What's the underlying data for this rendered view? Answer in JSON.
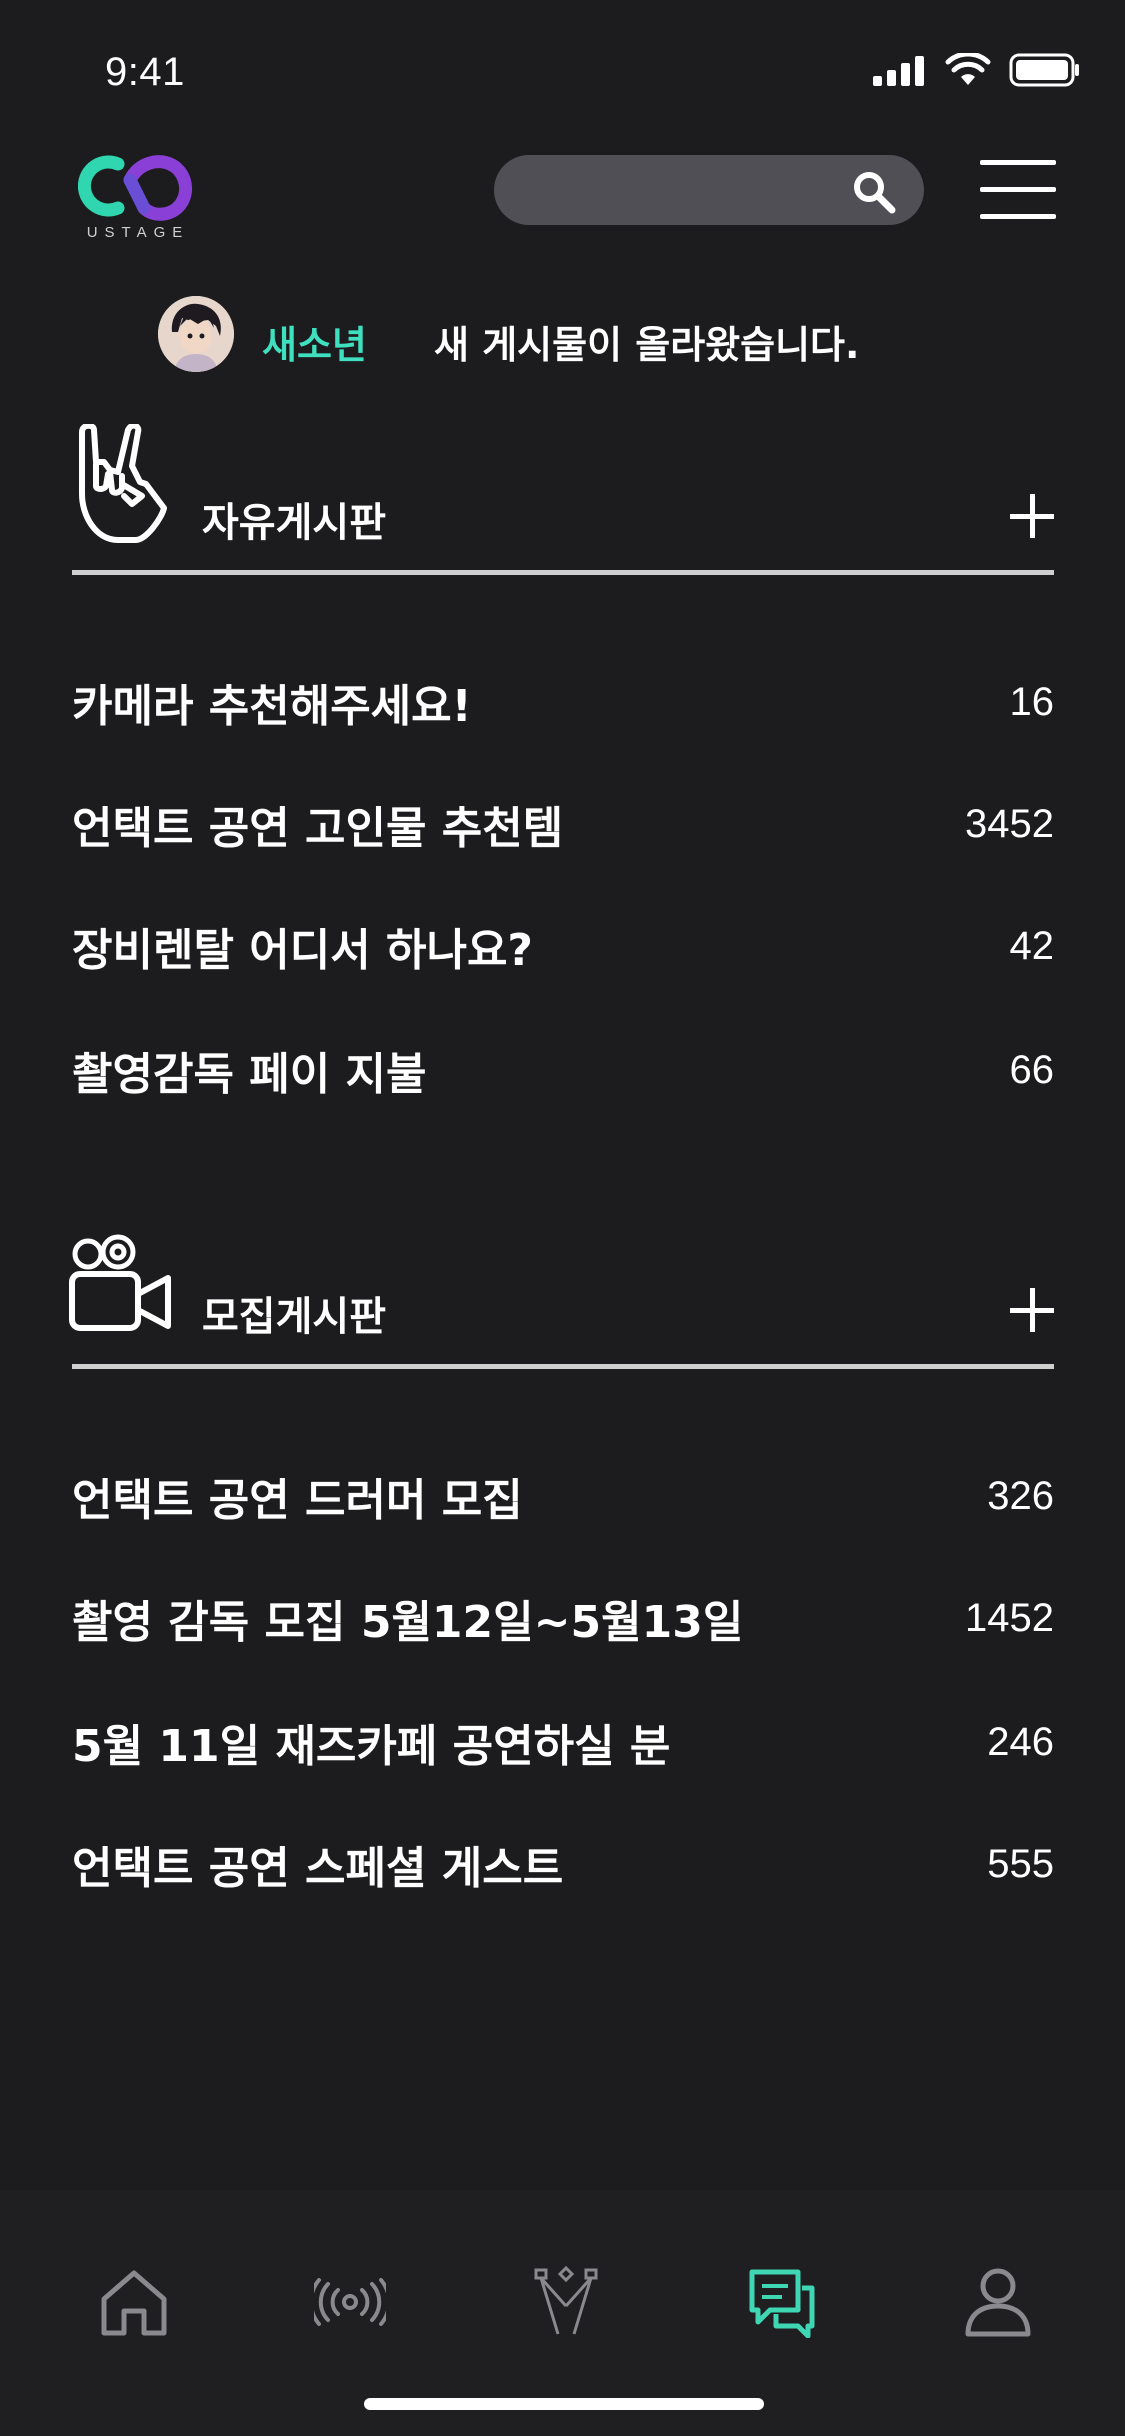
{
  "status_bar": {
    "time": "9:41"
  },
  "header": {
    "logo_text": "USTAGE",
    "search_icon": "search-icon",
    "menu_icon": "hamburger-menu-icon"
  },
  "notification": {
    "user": "새소년",
    "message": "새 게시물이 올라왔습니다."
  },
  "boards": [
    {
      "title": "자유게시판",
      "icon": "rock-hand-icon",
      "posts": [
        {
          "title": "카메라 추천해주세요!",
          "count": "16"
        },
        {
          "title": "언택트 공연 고인물 추천템",
          "count": "3452"
        },
        {
          "title": "장비렌탈 어디서 하나요?",
          "count": "42"
        },
        {
          "title": "촬영감독 페이 지불",
          "count": "66"
        }
      ]
    },
    {
      "title": "모집게시판",
      "icon": "video-camera-icon",
      "posts": [
        {
          "title": "언택트 공연 드러머 모집",
          "count": "326"
        },
        {
          "title": "촬영 감독 모집 5월12일~5월13일",
          "count": "1452"
        },
        {
          "title": "5월 11일 재즈카페 공연하실 분",
          "count": "246"
        },
        {
          "title": "언택트 공연 스페셜 게스트",
          "count": "555"
        }
      ]
    }
  ],
  "tabbar": {
    "tabs": [
      {
        "icon": "home-icon",
        "active": false
      },
      {
        "icon": "broadcast-icon",
        "active": false
      },
      {
        "icon": "stage-lights-icon",
        "active": false
      },
      {
        "icon": "chat-icon",
        "active": true
      },
      {
        "icon": "profile-icon",
        "active": false
      }
    ],
    "active_color": "#3fd6b4",
    "inactive_color": "#8a8a8e"
  },
  "colors": {
    "background": "#1c1c1e",
    "accent": "#3fe0c0",
    "logo_teal": "#2fd6b0",
    "logo_purple": "#8a3fd6"
  }
}
